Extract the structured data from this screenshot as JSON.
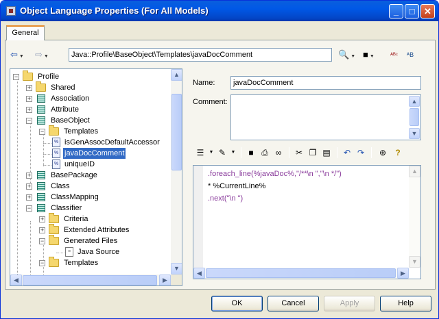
{
  "window": {
    "title": "Object Language Properties (For All Models)",
    "min": "_",
    "max": "□",
    "close": "✕"
  },
  "tabs": [
    {
      "label": "General"
    }
  ],
  "toolbar": {
    "back": "⇦",
    "forward": "⇨",
    "path": "Java::Profile\\BaseObject\\Templates\\javaDocComment",
    "find": "🔍",
    "save": "💾",
    "spell": "ᴬᴮᶜ",
    "replace": "ᴬB"
  },
  "tree": {
    "items": [
      {
        "label": "Profile",
        "icon": "folder-icon",
        "expander": "minus"
      },
      {
        "label": "Shared",
        "icon": "folder-icon",
        "expander": "plus"
      },
      {
        "label": "Association",
        "icon": "metaclass-icon",
        "expander": "plus"
      },
      {
        "label": "Attribute",
        "icon": "metaclass-icon",
        "expander": "plus"
      },
      {
        "label": "BaseObject",
        "icon": "metaclass-icon",
        "expander": "minus"
      },
      {
        "label": "Templates",
        "icon": "folder-icon",
        "expander": "minus"
      },
      {
        "label": "isGenAssocDefaultAccessor",
        "icon": "template-icon",
        "expander": ""
      },
      {
        "label": "javaDocComment",
        "icon": "template-icon",
        "expander": "",
        "selected": true
      },
      {
        "label": "uniqueID",
        "icon": "template-icon",
        "expander": ""
      },
      {
        "label": "BasePackage",
        "icon": "metaclass-icon",
        "expander": "plus"
      },
      {
        "label": "Class",
        "icon": "metaclass-icon",
        "expander": "plus"
      },
      {
        "label": "ClassMapping",
        "icon": "metaclass-icon",
        "expander": "plus"
      },
      {
        "label": "Classifier",
        "icon": "metaclass-icon",
        "expander": "minus"
      },
      {
        "label": "Criteria",
        "icon": "folder-icon",
        "expander": "plus"
      },
      {
        "label": "Extended Attributes",
        "icon": "folder-icon",
        "expander": "plus"
      },
      {
        "label": "Generated Files",
        "icon": "folder-icon",
        "expander": "minus"
      },
      {
        "label": "Java Source",
        "icon": "file-icon",
        "expander": ""
      },
      {
        "label": "Templates",
        "icon": "folder-icon",
        "expander": "minus"
      }
    ]
  },
  "form": {
    "name_label": "Name:",
    "name_value": "javaDocComment",
    "comment_label": "Comment:",
    "comment_value": ""
  },
  "editor": {
    "lines": [
      ".foreach_line(%javaDoc%,\"/**\\n \",\"\\n */\")",
      "* %CurrentLine%",
      ".next(\"\\n \")"
    ]
  },
  "buttons": {
    "ok": "OK",
    "cancel": "Cancel",
    "apply": "Apply",
    "help": "Help"
  }
}
